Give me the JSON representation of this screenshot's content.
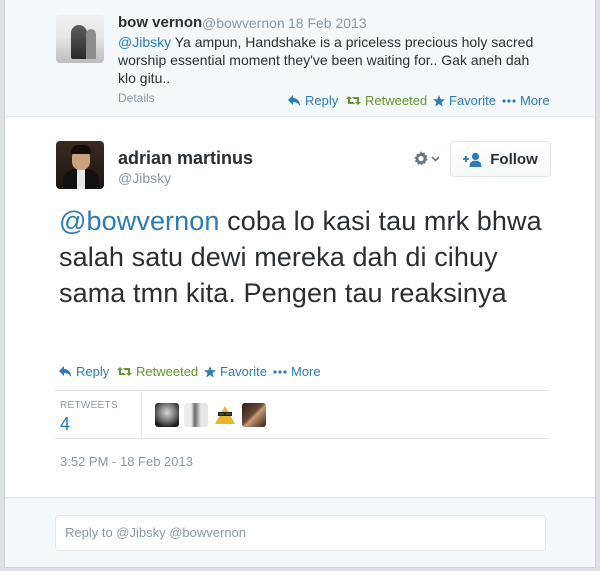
{
  "parent_tweet": {
    "name": "bow vernon",
    "handle": "@bowvernon",
    "separator": "·",
    "date": "18 Feb 2013",
    "mention": "@Jibsky",
    "text": " Ya ampun, Handshake is a priceless precious holy sacred worship essential moment they've been waiting for.. Gak aneh dah klo gitu..",
    "details_label": "Details",
    "actions": {
      "reply": "Reply",
      "retweeted": "Retweeted",
      "favorite": "Favorite",
      "more": "More"
    }
  },
  "main_tweet": {
    "name": "adrian martinus",
    "handle": "@Jibsky",
    "follow_label": "Follow",
    "mention": "@bowvernon",
    "text": " coba lo kasi tau mrk bhwa salah satu dewi mereka dah di cihuy sama tmn kita. Pengen tau reaksinya",
    "actions": {
      "reply": "Reply",
      "retweeted": "Retweeted",
      "favorite": "Favorite",
      "more": "More"
    },
    "retweets_label": "RETWEETS",
    "retweets_count": "4",
    "timestamp": "3:52 PM - 18 Feb 2013"
  },
  "reply_box": {
    "placeholder": "Reply to @Jibsky @bowvernon"
  },
  "colors": {
    "link": "#2b7bb9",
    "retweeted": "#609928",
    "muted": "#8899a6",
    "text": "#292f33"
  },
  "icons": [
    "reply-icon",
    "retweet-icon",
    "star-icon",
    "more-dots-icon",
    "gear-icon",
    "chevron-down-icon",
    "add-user-icon"
  ]
}
